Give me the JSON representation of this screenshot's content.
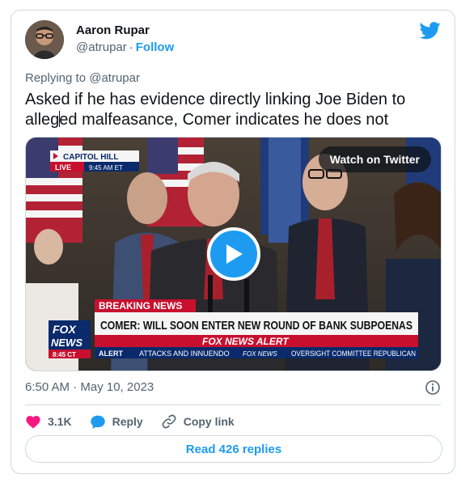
{
  "author": {
    "name": "Aaron Rupar",
    "handle": "@atrupar",
    "separator": "·",
    "follow_label": "Follow"
  },
  "reply_context": {
    "prefix": "Replying to",
    "handle": "@atrupar"
  },
  "tweet": {
    "text_before_caret": "Asked if he has evidence directly linking Joe Biden to alleg",
    "text_after_caret": "ed malfeasance, Comer indicates he does not"
  },
  "media": {
    "watch_label": "Watch on Twitter",
    "chyron": {
      "location": "CAPITOL HILL",
      "live": "LIVE",
      "live_time": "9:45 AM ET",
      "breaking": "BREAKING NEWS",
      "headline": "COMER: WILL SOON ENTER NEW ROUND OF BANK SUBPOENAS",
      "alert_banner": "FOX NEWS ALERT",
      "logo_line1": "FOX",
      "logo_line2": "NEWS",
      "clock": "8:45 CT",
      "alert_tag": "ALERT",
      "ticker1": "ATTACKS AND INNUENDO",
      "ticker_brand": "FOX NEWS",
      "ticker2": "OVERSIGHT COMMITTEE REPUBLICAN"
    }
  },
  "meta": {
    "timestamp": "6:50 AM · May 10, 2023"
  },
  "actions": {
    "likes": "3.1K",
    "reply_label": "Reply",
    "copy_label": "Copy link"
  },
  "replies_button": "Read 426 replies",
  "colors": {
    "accent": "#1d9bf0",
    "like": "#f91880",
    "muted": "#536471",
    "border": "#cfd9de",
    "fox_red": "#c8102e",
    "fox_blue": "#0a2a6b"
  }
}
